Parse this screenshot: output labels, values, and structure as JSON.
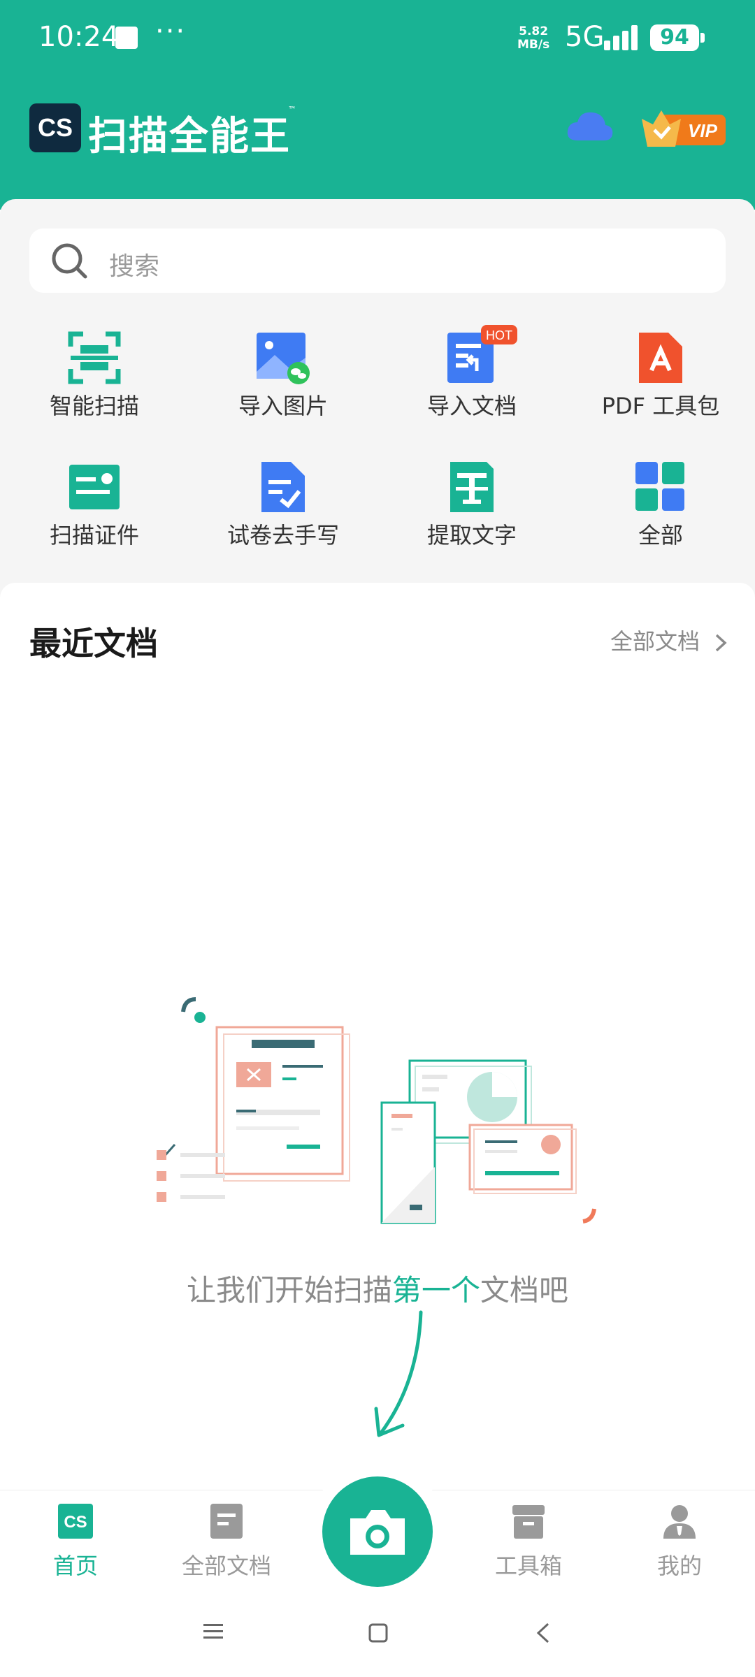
{
  "status_bar": {
    "time": "10:24",
    "dots": "···",
    "speed_value": "5.82",
    "speed_unit": "MB/s",
    "network": "5G",
    "battery": "94"
  },
  "header": {
    "logo_text": "CS",
    "app_title": "扫描全能王",
    "trademark": "™",
    "cloud_icon": "cloud-icon",
    "vip_label": "VIP"
  },
  "search": {
    "placeholder": "搜索"
  },
  "tools": [
    {
      "label": "智能扫描",
      "icon": "smart-scan-icon"
    },
    {
      "label": "导入图片",
      "icon": "import-image-icon"
    },
    {
      "label": "导入文档",
      "icon": "import-document-icon",
      "badge": "HOT"
    },
    {
      "label": "PDF 工具包",
      "icon": "pdf-toolkit-icon"
    },
    {
      "label": "扫描证件",
      "icon": "id-scan-icon"
    },
    {
      "label": "试卷去手写",
      "icon": "remove-handwriting-icon"
    },
    {
      "label": "提取文字",
      "icon": "extract-text-icon"
    },
    {
      "label": "全部",
      "icon": "all-tools-icon"
    }
  ],
  "recent": {
    "title": "最近文档",
    "all_docs_link": "全部文档",
    "empty_pre": "让我们开始扫描",
    "empty_highlight": "第一个",
    "empty_post": "文档吧"
  },
  "bottom_nav": [
    {
      "label": "首页",
      "active": true,
      "icon_text": "CS"
    },
    {
      "label": "全部文档",
      "active": false
    },
    {
      "label": "工具箱",
      "active": false
    },
    {
      "label": "我的",
      "active": false
    }
  ],
  "colors": {
    "brand": "#19b394",
    "vip_orange": "#f07a1a",
    "pdf_red": "#f0522d",
    "doc_blue": "#3f7bf3"
  }
}
